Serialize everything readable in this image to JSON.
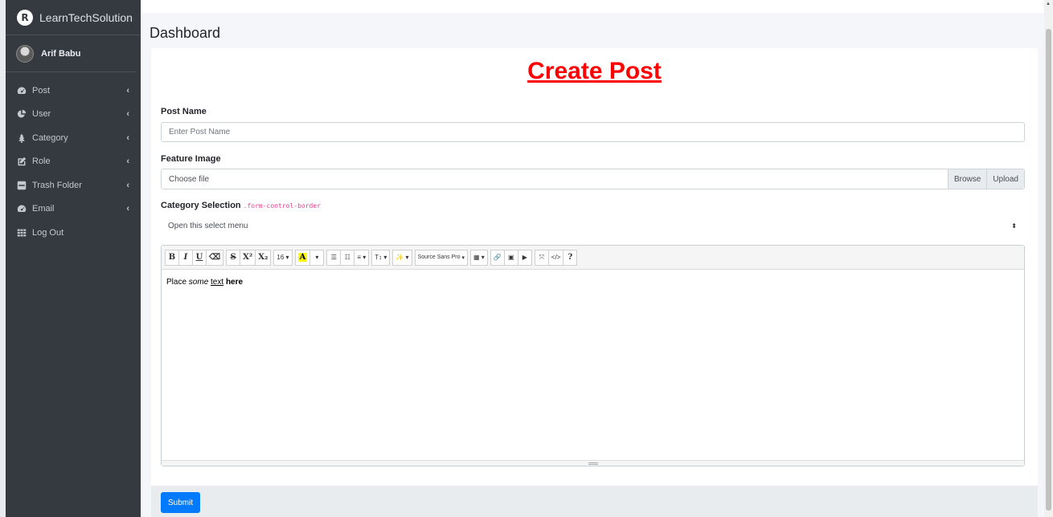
{
  "brand": {
    "name": "LearnTechSolution",
    "logo_letter": "R"
  },
  "user": {
    "name": "Arif Babu"
  },
  "sidebar": {
    "items": [
      {
        "label": "Post",
        "icon": "tachometer-icon",
        "has_caret": true
      },
      {
        "label": "User",
        "icon": "pie-chart-icon",
        "has_caret": true
      },
      {
        "label": "Category",
        "icon": "tree-icon",
        "has_caret": true
      },
      {
        "label": "Role",
        "icon": "edit-icon",
        "has_caret": true
      },
      {
        "label": "Trash Folder",
        "icon": "trash-box-icon",
        "has_caret": true
      },
      {
        "label": "Email",
        "icon": "tachometer-icon",
        "has_caret": true
      },
      {
        "label": "Log Out",
        "icon": "grid-icon",
        "has_caret": false
      }
    ],
    "caret": "‹"
  },
  "header": {
    "title": "Dashboard"
  },
  "form": {
    "title": "Create Post",
    "post_name": {
      "label": "Post Name",
      "placeholder": "Enter Post Name"
    },
    "feature_image": {
      "label": "Feature Image",
      "file_label": "Choose file",
      "browse": "Browse",
      "upload": "Upload"
    },
    "category": {
      "label": "Category Selection",
      "code_note": ".form-control-border",
      "selected": "Open this select menu"
    },
    "editor": {
      "toolbar": {
        "font_size": "16",
        "font_name": "Source Sans Pro",
        "help": "?"
      },
      "content": {
        "part1": "Place ",
        "italic": "some",
        "space1": " ",
        "underline": "text",
        "space2": " ",
        "bold": "here"
      }
    },
    "submit_label": "Submit"
  },
  "colors": {
    "accent": "#007bff",
    "title_red": "#ff0000",
    "sidebar_bg": "#343a40"
  }
}
